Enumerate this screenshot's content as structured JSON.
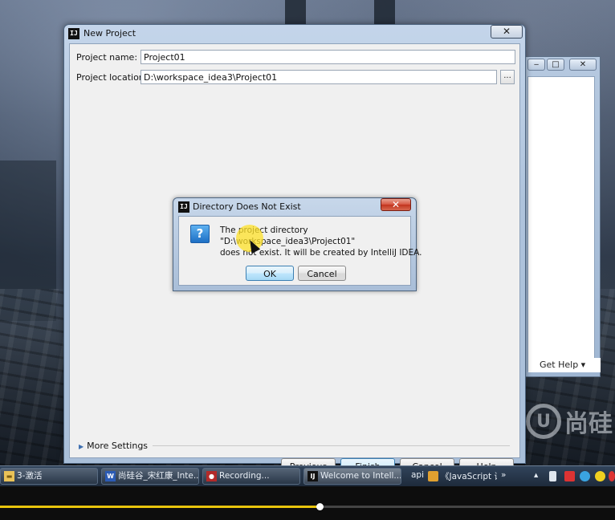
{
  "new_project": {
    "title": "New Project",
    "close_glyph": "✕",
    "name_label": "Project name:",
    "name_value": "Project01",
    "location_label": "Project location:",
    "location_value": "D:\\workspace_idea3\\Project01",
    "browse_label": "...",
    "more_settings": "More Settings",
    "buttons": {
      "previous": "Previous",
      "finish": "Finish",
      "cancel": "Cancel",
      "help": "Help"
    }
  },
  "dialog": {
    "title": "Directory Does Not Exist",
    "close_glyph": "✕",
    "icon_glyph": "?",
    "message_lines": [
      "The project directory",
      "\"D:\\workspace_idea3\\Project01\"",
      "does not exist. It will be created by IntelliJ IDEA."
    ],
    "ok": "OK",
    "cancel": "Cancel"
  },
  "background_window": {
    "get_help": "Get Help ▾",
    "buttons": [
      "‒",
      "□",
      "✕"
    ]
  },
  "taskbar": {
    "items": [
      {
        "label": "3-激活",
        "icon": "folder-icon",
        "active": false
      },
      {
        "label": "尚硅谷_宋红康_Inte...",
        "icon": "word-icon",
        "active": false
      },
      {
        "label": "Recording...",
        "icon": "record-icon",
        "active": false
      },
      {
        "label": "Welcome to Intell...",
        "icon": "intellij-icon",
        "active": true
      }
    ],
    "tray_left": "api",
    "tray_browser_text": "《JavaScript 讲",
    "tray_chevron": "»"
  },
  "watermark": {
    "circle_letter": "U",
    "text": "尚硅"
  },
  "player": {
    "progress": 0.52
  },
  "colors": {
    "progress_fill": "#e8c40c",
    "cursor_highlight": "#ffe128",
    "dialog_close": "#c2341d"
  }
}
